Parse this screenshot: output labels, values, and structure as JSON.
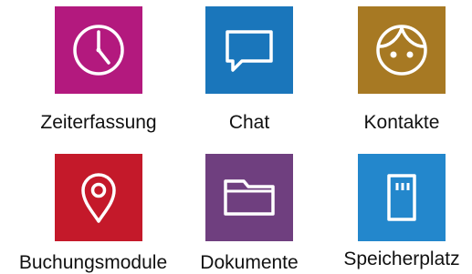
{
  "tiles": [
    {
      "label": "Zeiterfassung",
      "icon": "clock-icon",
      "color": "#b3197e"
    },
    {
      "label": "Chat",
      "icon": "chat-bubble-icon",
      "color": "#1a76bb"
    },
    {
      "label": "Kontakte",
      "icon": "face-icon",
      "color": "#a77923"
    },
    {
      "label": "Buchungsmodule",
      "icon": "map-pin-icon",
      "color": "#c4192a"
    },
    {
      "label": "Dokumente",
      "icon": "folder-icon",
      "color": "#6f3f7f"
    },
    {
      "label": "Speicherplatz",
      "icon": "sd-card-icon",
      "color": "#2387cc"
    }
  ]
}
